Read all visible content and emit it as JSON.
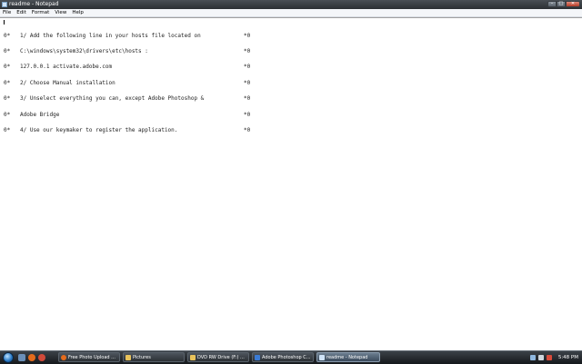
{
  "window": {
    "title": "readme - Notepad",
    "controls": {
      "minimize": "–",
      "maximize": "□",
      "close": "✕"
    }
  },
  "menu": {
    "items": [
      "File",
      "Edit",
      "Format",
      "View",
      "Help"
    ]
  },
  "editor": {
    "lines": [
      {
        "prefix": "0*",
        "text": "1/ Add the following line in your hosts file located on",
        "suffix": "*0"
      },
      {
        "prefix": "0*",
        "text": "C:\\windows\\system32\\drivers\\etc\\hosts :",
        "suffix": "*0"
      },
      {
        "prefix": "0*",
        "text": "127.0.0.1 activate.adobe.com",
        "suffix": "*0"
      },
      {
        "prefix": "0*",
        "text": "2/ Choose Manual installation",
        "suffix": "*0"
      },
      {
        "prefix": "0*",
        "text": "3/ Unselect everything you can, except Adobe Photoshop &",
        "suffix": "*0"
      },
      {
        "prefix": "0*",
        "text": "Adobe Bridge",
        "suffix": "*0"
      },
      {
        "prefix": "0*",
        "text": "4/ Use our keymaker to register the application.",
        "suffix": "*0"
      }
    ]
  },
  "taskbar": {
    "quick_launch": [
      "desktop-icon",
      "firefox-icon",
      "media-icon"
    ],
    "buttons": [
      {
        "label": "Free Photo Upload ...",
        "icon": "firefox-icon",
        "icon_color": "#e46b1c",
        "active": false
      },
      {
        "label": "Pictures",
        "icon": "folder-icon",
        "icon_color": "#e8c25a",
        "active": false
      },
      {
        "label": "DVD RW Drive (F:) ...",
        "icon": "folder-icon",
        "icon_color": "#e8c25a",
        "active": false
      },
      {
        "label": "Adobe Photoshop C...",
        "icon": "photoshop-icon",
        "icon_color": "#3a7bd5",
        "active": false
      },
      {
        "label": "readme - Notepad",
        "icon": "notepad-icon",
        "icon_color": "#cfe3f7",
        "active": true
      }
    ],
    "tray_icons": [
      "network-icon",
      "volume-icon",
      "security-icon"
    ],
    "time": "5:48 PM"
  }
}
